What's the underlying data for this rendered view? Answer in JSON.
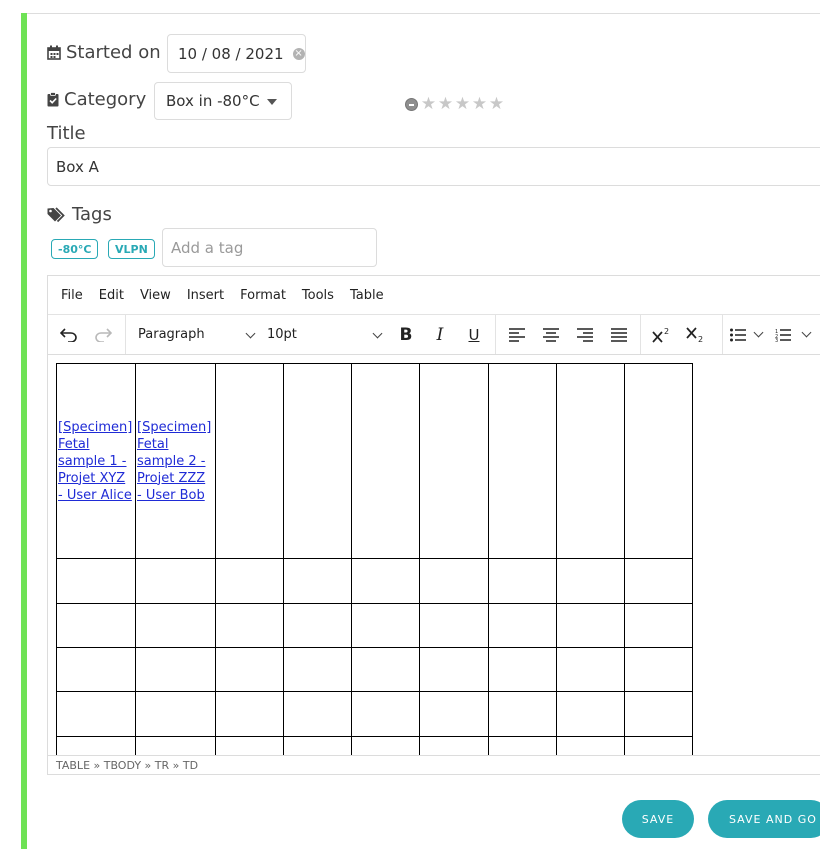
{
  "form": {
    "started_on_label": "Started on",
    "date_value": "10 / 08 / 2021",
    "category_label": "Category",
    "category_value": "Box in -80°C",
    "rating": {
      "value": 0,
      "max": 5
    },
    "title_label": "Title",
    "title_value": "Box A",
    "tags_label": "Tags",
    "tags": [
      "-80°C",
      "VLPN"
    ],
    "tag_placeholder": "Add a tag"
  },
  "editor": {
    "menu": [
      "File",
      "Edit",
      "View",
      "Insert",
      "Format",
      "Tools",
      "Table"
    ],
    "block_format": "Paragraph",
    "font_size": "10pt",
    "table": {
      "links": [
        [
          "[Specimen]",
          "Fetal",
          "sample 1 -",
          "Projet XYZ",
          "- User Alice"
        ],
        [
          "[Specimen]",
          "Fetal",
          "sample 2 -",
          "Projet ZZZ",
          "- User Bob"
        ]
      ]
    },
    "status_path": "TABLE » TBODY » TR » TD"
  },
  "buttons": {
    "save": "SAVE",
    "save_and_go": "SAVE AND GO BACK"
  },
  "colors": {
    "accent_bar": "#6ee255",
    "primary": "#29a9b5",
    "link": "#1f2bd6"
  }
}
